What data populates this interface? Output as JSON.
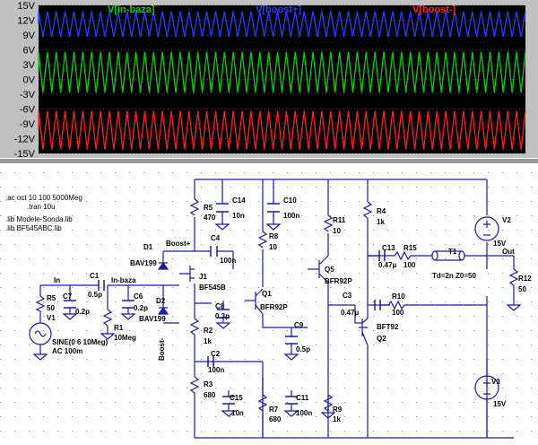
{
  "plot": {
    "traces": [
      {
        "name": "V[in-baza]",
        "color": "#00d000"
      },
      {
        "name": "V[boost+]",
        "color": "#2040ff"
      },
      {
        "name": "V[boost-]",
        "color": "#ff2020"
      }
    ],
    "y_ticks": [
      "15V",
      "12V",
      "9V",
      "6V",
      "3V",
      "0V",
      "-3V",
      "-6V",
      "-9V",
      "-12V",
      "-15V"
    ],
    "y_range": [
      -15,
      15
    ],
    "bands": [
      {
        "trace": "V[boost+]",
        "min": 8.6,
        "max": 13.8
      },
      {
        "trace": "V[in-baza]",
        "min": -2.7,
        "max": 5.6
      },
      {
        "trace": "V[boost-]",
        "min": -14.2,
        "max": -6.4
      }
    ],
    "cycles": 55
  },
  "directives": [
    ";ac oct 10 100 5000Meg",
    ".tran 10u",
    ".lib Modele-Sonda.lib",
    ".lib BF545ABC.lib"
  ],
  "components": {
    "r5": {
      "ref": "R5",
      "value": "50"
    },
    "r5_top": {
      "ref": "R5",
      "value": "470"
    },
    "c14": {
      "ref": "C14",
      "value": "10n"
    },
    "c10": {
      "ref": "C10",
      "value": "100n"
    },
    "r11": {
      "ref": "R11",
      "value": "10"
    },
    "r4": {
      "ref": "R4",
      "value": "1k"
    },
    "v2": {
      "ref": "V2",
      "value": "15V"
    },
    "d1": {
      "ref": "D1",
      "value": "BAV199"
    },
    "c4": {
      "ref": "C4",
      "value": "100n"
    },
    "r8": {
      "ref": "R8",
      "value": "10"
    },
    "q5": {
      "ref": "Q5",
      "value": "BFR92P"
    },
    "c13": {
      "ref": "C13",
      "value": "0.47µ"
    },
    "r15": {
      "ref": "R15",
      "value": "100"
    },
    "t1": {
      "ref": "T1",
      "value": "Td=2n Z0=50"
    },
    "c1": {
      "ref": "C1",
      "value": "0.5p"
    },
    "c7": {
      "ref": "C7",
      "value": "0.2p"
    },
    "j1": {
      "ref": "J1",
      "value": "BF545B"
    },
    "q1": {
      "ref": "Q1",
      "value": "BFR92P"
    },
    "c3": {
      "ref": "C3",
      "value": "0.47µ"
    },
    "r10": {
      "ref": "R10",
      "value": "100"
    },
    "r12": {
      "ref": "R12",
      "value": "50"
    },
    "v1": {
      "ref": "V1",
      "value": "SINE(0 6 10Meg)",
      "extra": "AC 100m"
    },
    "r1": {
      "ref": "R1",
      "value": "10Meg"
    },
    "c6": {
      "ref": "C6",
      "value": "0.2p"
    },
    "d2": {
      "ref": "D2",
      "value": "BAV199"
    },
    "c8": {
      "ref": "C8",
      "value": "0.3p"
    },
    "c9": {
      "ref": "C9",
      "value": "0.5p"
    },
    "q2": {
      "ref": "Q2",
      "value": "BFT92"
    },
    "r2": {
      "ref": "R2",
      "value": "1k"
    },
    "c2": {
      "ref": "C2",
      "value": "100n"
    },
    "r3": {
      "ref": "R3",
      "value": "680"
    },
    "c15": {
      "ref": "C15",
      "value": "10n"
    },
    "r7": {
      "ref": "R7",
      "value": "680"
    },
    "c11": {
      "ref": "C11",
      "value": "100n"
    },
    "r9": {
      "ref": "R9",
      "value": "1k"
    },
    "v3": {
      "ref": "V3",
      "value": "15V"
    }
  },
  "nets": {
    "in": "In",
    "in_baza": "In-baza",
    "boost_plus": "Boost+",
    "boost_minus": "Boost-",
    "out": "Out"
  }
}
